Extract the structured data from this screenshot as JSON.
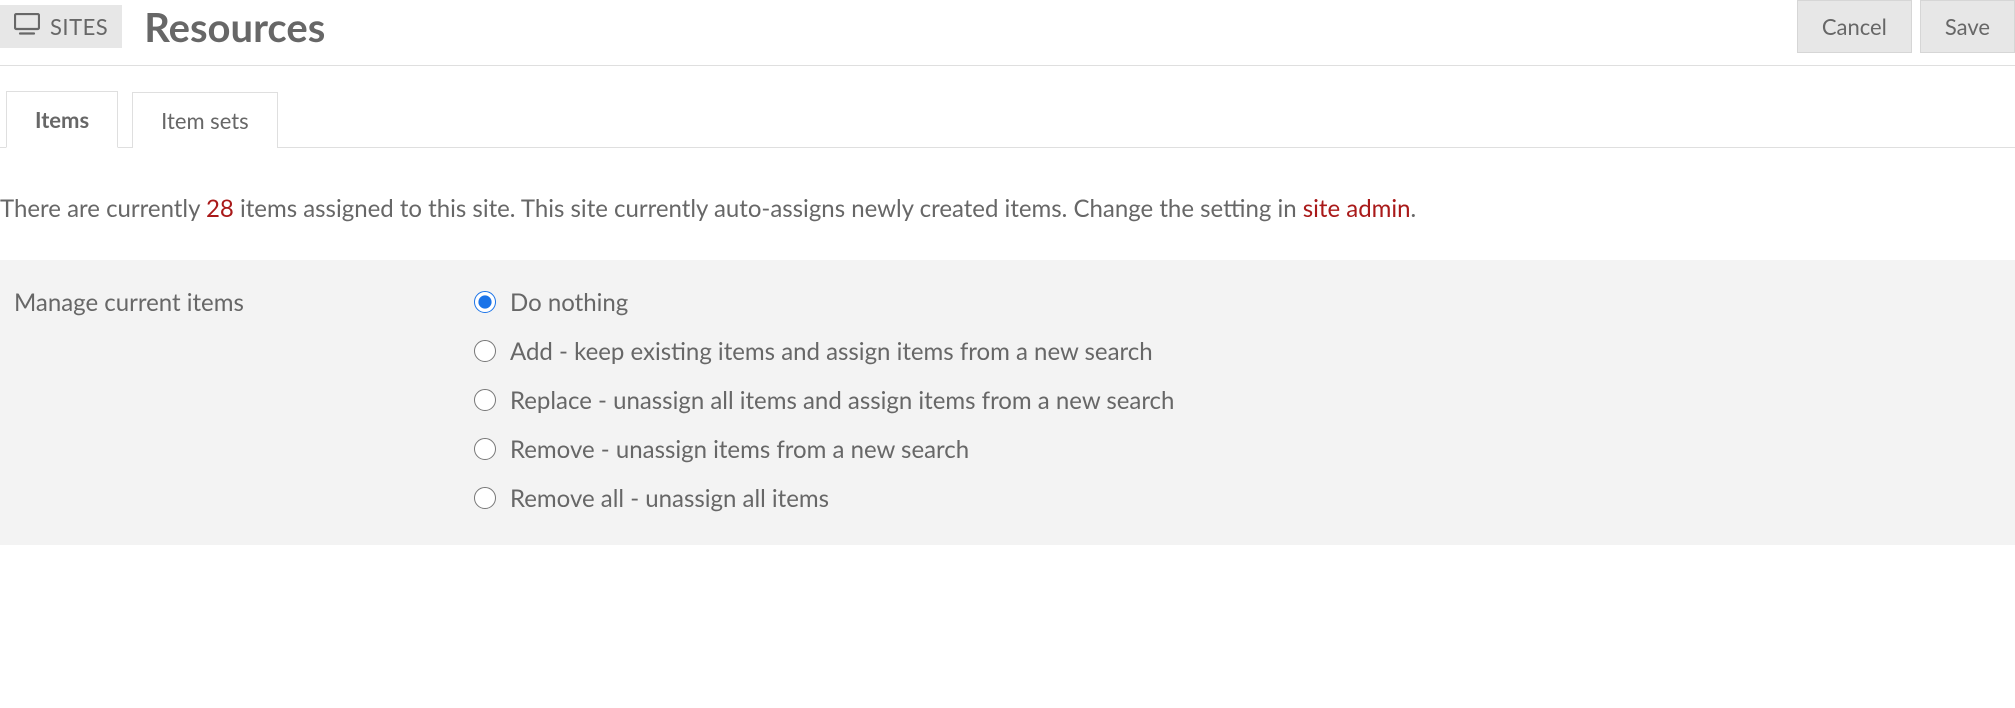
{
  "header": {
    "breadcrumb_label": "SITES",
    "title": "Resources",
    "cancel_label": "Cancel",
    "save_label": "Save"
  },
  "tabs": {
    "items_label": "Items",
    "itemsets_label": "Item sets",
    "active": "items"
  },
  "info": {
    "prefix": "There are currently ",
    "count": "28",
    "middle": " items assigned to this site. This site currently auto-assigns newly created items. Change the setting in ",
    "link_text": "site admin",
    "suffix": "."
  },
  "manage": {
    "label": "Manage current items",
    "options": {
      "nothing": "Do nothing",
      "add": "Add - keep existing items and assign items from a new search",
      "replace": "Replace - unassign all items and assign items from a new search",
      "remove": "Remove - unassign items from a new search",
      "remove_all": "Remove all - unassign all items"
    },
    "selected": "nothing"
  }
}
